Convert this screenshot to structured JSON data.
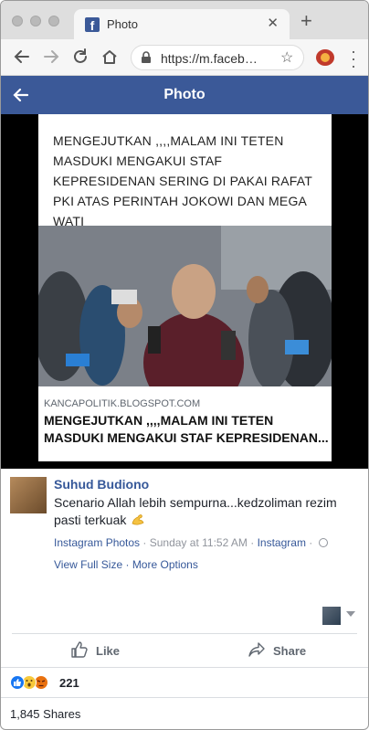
{
  "browser": {
    "tab_title": "Photo",
    "url": "https://m.faceb…",
    "new_tab_symbol": "+",
    "close_symbol": "✕",
    "star_symbol": "☆"
  },
  "fb": {
    "header_title": "Photo",
    "brand_color": "#3b5998"
  },
  "photo": {
    "headline": "MENGEJUTKAN ,,,,MALAM INI TETEN MASDUKI MENGAKUI STAF KEPRESIDENAN SERING DI PAKAI RAFAT PKI ATAS PERINTAH JOKOWI DAN MEGA WATI",
    "source": "KANCAPOLITIK.BLOGSPOT.COM",
    "caption": "MENGEJUTKAN ,,,,MALAM INI TETEN MASDUKI MENGAKUI STAF KEPRESIDENAN..."
  },
  "post": {
    "author": "Suhud Budiono",
    "text": "Scenario Allah lebih sempurna...kedzoliman rezim pasti terkuak",
    "meta_app": "Instagram Photos",
    "meta_sep1": " · ",
    "meta_time": "Sunday at 11:52 AM",
    "meta_sep2": " · ",
    "meta_source": "Instagram",
    "meta_sep3": " · ",
    "link_full_size": "View Full Size",
    "link_sep": " · ",
    "link_more": "More Options"
  },
  "actions": {
    "like": "Like",
    "share": "Share"
  },
  "stats": {
    "reaction_count": "221",
    "shares": "1,845 Shares"
  },
  "icons": [
    "facebook-favicon",
    "back-arrow-icon",
    "forward-arrow-icon",
    "reload-icon",
    "home-icon",
    "lock-icon",
    "star-icon",
    "extension-icon",
    "menu-icon",
    "like-icon",
    "share-icon",
    "globe-icon",
    "muscle-emoji",
    "like-reaction-icon",
    "wow-reaction-icon",
    "angry-reaction-icon"
  ]
}
